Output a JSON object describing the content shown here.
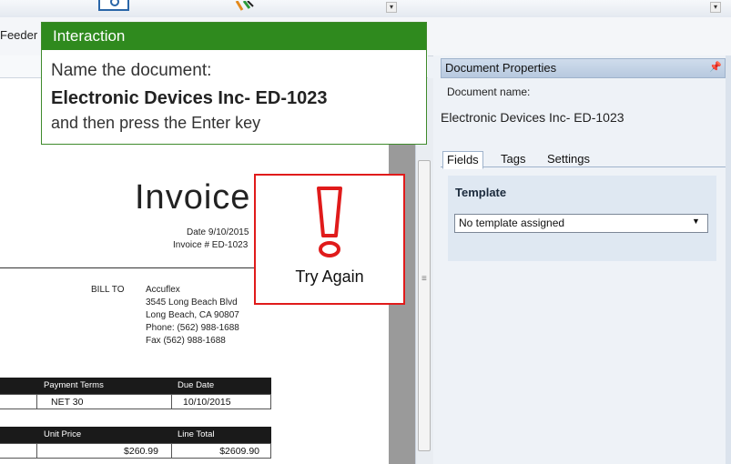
{
  "toolbar": {
    "dropdown_arrow": "▾"
  },
  "feeder_tab": "Feeder",
  "interaction": {
    "title": "Interaction",
    "line1": "Name the document:",
    "line2": "Electronic Devices Inc- ED-1023",
    "line3": "and then press the Enter key"
  },
  "try_again": {
    "label": "Try Again"
  },
  "invoice": {
    "title": "Invoice",
    "date": "Date 9/10/2015",
    "number": "Invoice # ED-1023",
    "bill_to_label": "BILL TO",
    "address": [
      "Accuflex",
      "3545 Long Beach Blvd",
      "Long Beach, CA 90807",
      "Phone: (562) 988-1688",
      "Fax (562) 988-1688"
    ],
    "terms_header": "Payment Terms",
    "due_header": "Due Date",
    "terms_value": "NET 30",
    "due_value": "10/10/2015",
    "unit_price_header": "Unit Price",
    "line_total_header": "Line Total",
    "unit_price_value": "$260.99",
    "line_total_value": "$2609.90"
  },
  "properties": {
    "title": "Document Properties",
    "pin_icon": "pin-icon",
    "name_label": "Document name:",
    "name_value": "Electronic Devices Inc- ED-1023",
    "tabs": [
      "Fields",
      "Tags",
      "Settings"
    ],
    "template_label": "Template",
    "template_value": "No template assigned"
  },
  "colors": {
    "interaction_header": "#2f8a1e",
    "try_again_border": "#e01b1b",
    "panel_header": "#b7c9df"
  }
}
